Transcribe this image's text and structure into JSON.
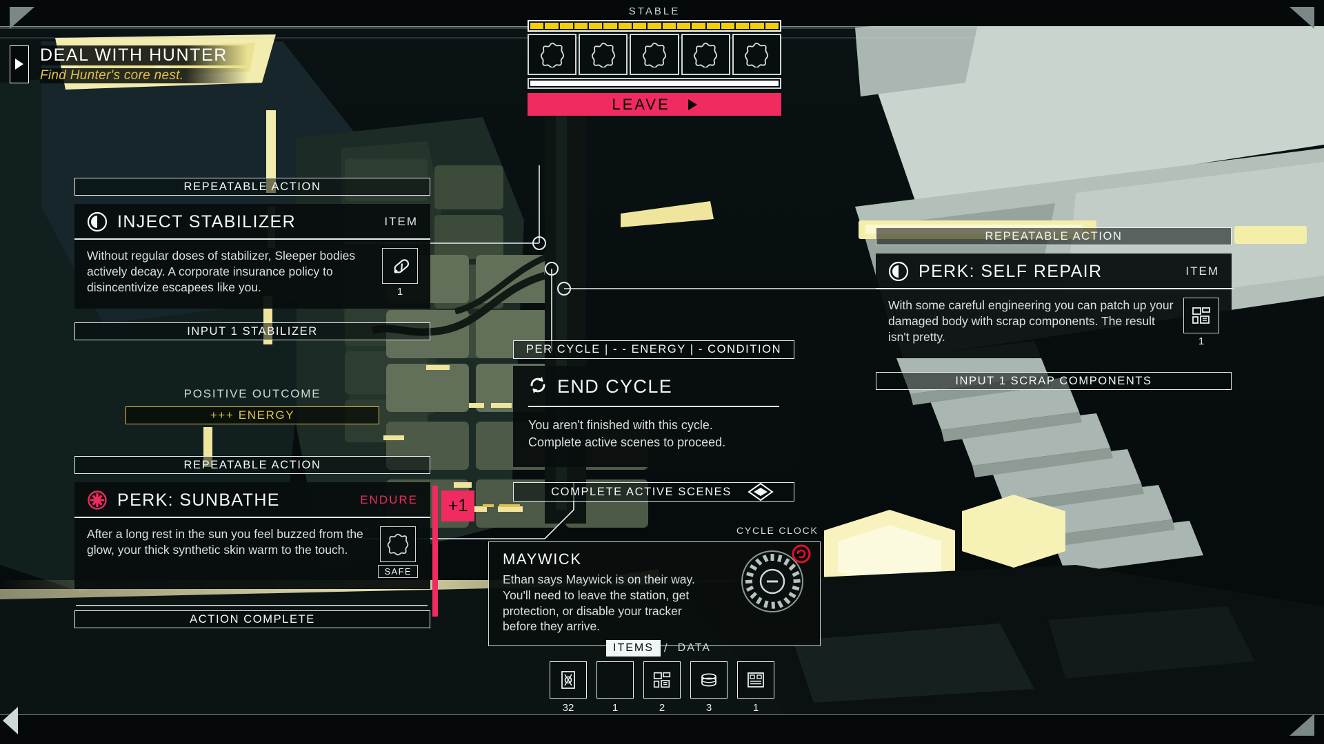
{
  "objective": {
    "title": "DEAL WITH HUNTER",
    "subtitle": "Find Hunter's core nest.",
    "arrow_icon": "play-triangle-icon"
  },
  "stable_panel": {
    "label": "STABLE",
    "bar_segments": 17,
    "bar_color": "#f2cf07",
    "slot_count": 5,
    "slot_icon": "dice-blob-icon",
    "under_fill_percent": 100,
    "leave_button": {
      "label": "LEAVE",
      "icon": "play-triangle-icon",
      "color": "#ef2b5f"
    }
  },
  "cards": [
    {
      "ribbon_top": "REPEATABLE ACTION",
      "icon": "half-filled-circle-icon",
      "title": "INJECT STABILIZER",
      "tag": "ITEM",
      "tag_style": "normal",
      "description": "Without regular doses of stabilizer, Sleeper bodies actively decay. A corporate insurance policy to disincentivize escapees like you.",
      "item_icon": "pill-capsule-icon",
      "item_qty": "1",
      "ribbon_bottom": "INPUT 1 STABILIZER"
    },
    {
      "ribbon_top": "REPEATABLE ACTION",
      "icon": "half-filled-circle-icon",
      "title": "PERK: SELF REPAIR",
      "tag": "ITEM",
      "tag_style": "normal",
      "description": "With some careful engineering you can patch up your damaged body with scrap components. The result isn't pretty.",
      "item_icon": "scrap-components-icon",
      "item_qty": "1",
      "ribbon_bottom": "INPUT 1 SCRAP COMPONENTS"
    },
    {
      "ribbon_top": "REPEATABLE ACTION",
      "icon": "red-cross-circle-icon",
      "title": "PERK: SUNBATHE",
      "tag": "ENDURE",
      "tag_style": "danger",
      "description": "After a long rest in the sun you feel buzzed from the glow, your thick synthetic skin warm to the touch.",
      "item_icon": "dice-blob-icon",
      "item_qty": "",
      "safe_label": "SAFE",
      "ribbon_bottom": "ACTION COMPLETE"
    }
  ],
  "outcome": {
    "label": "POSITIVE OUTCOME",
    "value": "+++ ENERGY",
    "color": "#e3c24b"
  },
  "end_cycle": {
    "ribbon_top": "PER CYCLE | - - ENERGY | - CONDITION",
    "icon": "refresh-cycle-icon",
    "title": "END CYCLE",
    "line1": "You aren't finished with this cycle.",
    "line2": "Complete active scenes to proceed.",
    "ribbon_bottom": "COMPLETE ACTIVE SCENES",
    "ribbon_bottom_icon": "diamond-node-icon"
  },
  "maywick": {
    "title": "MAYWICK",
    "body": "Ethan says Maywick is on their way. You'll need to leave the station, get protection, or disable your tracker before they arrive."
  },
  "cycle_clock": {
    "label": "CYCLE CLOCK",
    "segments": 20,
    "filled": 0,
    "center_icon": "minus-circle-icon",
    "alarm_icon": "red-alarm-icon",
    "alarm_color": "#e01030"
  },
  "items_bar": {
    "tabs": [
      {
        "label": "ITEMS",
        "active": true
      },
      {
        "label": "DATA",
        "active": false
      }
    ],
    "separator": "/",
    "items": [
      {
        "icon": "currency-chit-icon",
        "count": "32"
      },
      {
        "icon": "empty-slot-icon",
        "count": "1"
      },
      {
        "icon": "scrap-components-icon",
        "count": "2"
      },
      {
        "icon": "canister-icon",
        "count": "3"
      },
      {
        "icon": "circuit-board-icon",
        "count": "1"
      }
    ]
  },
  "plus_one_marker": {
    "value": "+1",
    "color": "#ef2b5f"
  }
}
